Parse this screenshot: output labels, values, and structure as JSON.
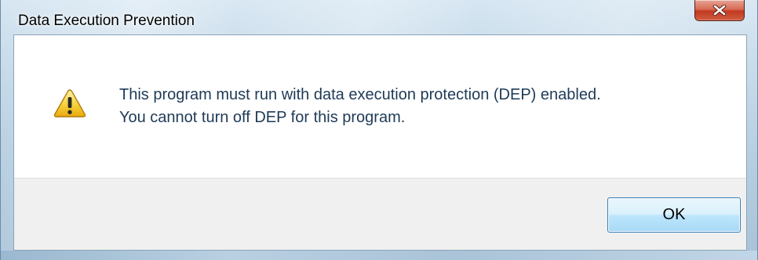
{
  "window": {
    "title": "Data Execution Prevention",
    "close_icon": "close-icon"
  },
  "message": {
    "icon": "warning-icon",
    "line1": "This program must run with data execution protection (DEP) enabled.",
    "line2": "You cannot turn off DEP for this program."
  },
  "buttons": {
    "ok_label": "OK"
  },
  "colors": {
    "message_text": "#1e3a56",
    "close_button": "#c23a21",
    "ok_button_border": "#3c7fb1",
    "button_area_bg": "#f0f0f0"
  }
}
